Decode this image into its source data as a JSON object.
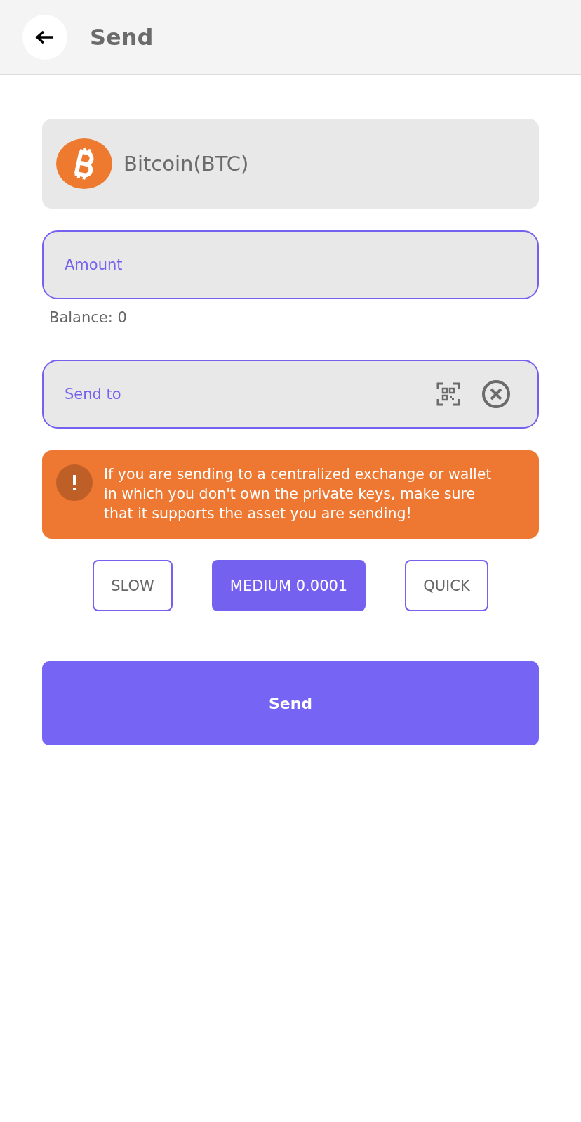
{
  "header": {
    "title": "Send"
  },
  "asset": {
    "name": "Bitcoin(BTC)"
  },
  "amount_field": {
    "placeholder": "Amount"
  },
  "balance": "Balance: 0",
  "send_to_field": {
    "placeholder": "Send to"
  },
  "warning": "If you are sending to a centralized exchange or wallet in which you don't own the private keys, make sure that it supports the asset you are sending!",
  "fee_options": [
    {
      "label": "SLOW",
      "selected": false
    },
    {
      "label": "MEDIUM 0.0001",
      "selected": true
    },
    {
      "label": "QUICK",
      "selected": false
    }
  ],
  "send_button": "Send"
}
